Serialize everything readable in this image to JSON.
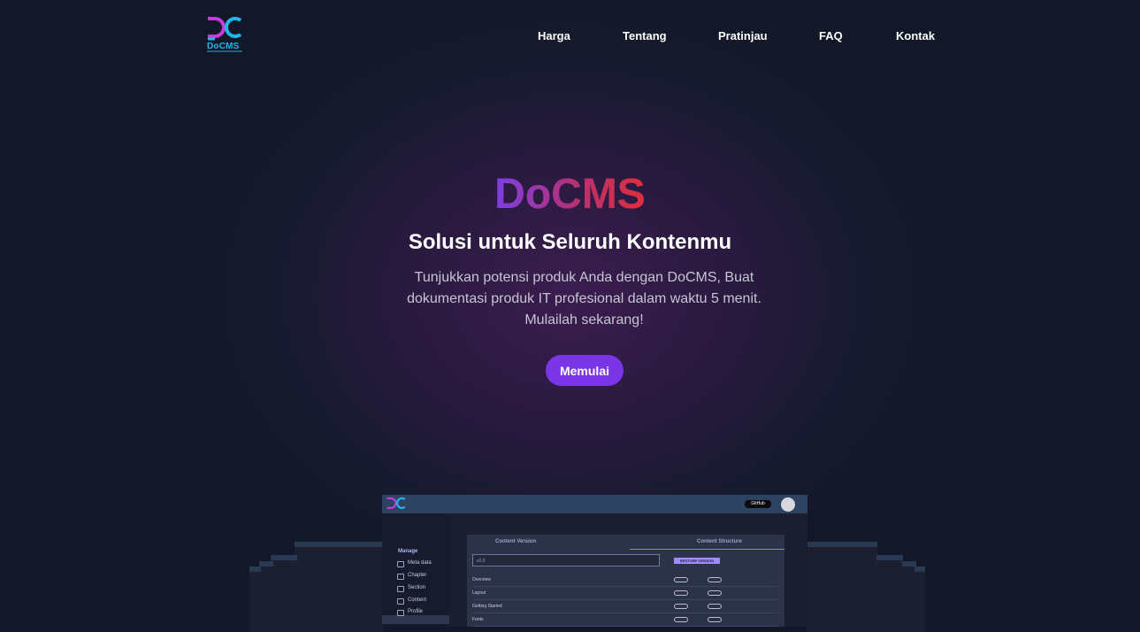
{
  "brand": {
    "name": "DoCMS"
  },
  "nav": {
    "items": [
      "Harga",
      "Tentang",
      "Pratinjau",
      "FAQ",
      "Kontak"
    ]
  },
  "hero": {
    "title": "DoCMS",
    "subtitle": "Solusi untuk Seluruh Kontenmu",
    "description": "Tunjukkan potensi produk Anda dengan DoCMS, Buat dokumentasi produk IT profesional dalam waktu 5 menit. Mulailah sekarang!",
    "cta_label": "Memulai"
  },
  "preview": {
    "github_label": "GitHub",
    "sidebar_heading": "Manage",
    "sidebar_items": [
      "Meta data",
      "Chapter",
      "Section",
      "Content",
      "Profile"
    ],
    "tabs": [
      "Content Version",
      "Content Structure"
    ],
    "input_value": "v2.0",
    "button_label": "RESTORE VERSION",
    "rows": [
      "Overview",
      "Layout",
      "Getting Started",
      "Fonts"
    ]
  },
  "colors": {
    "accent": "#7a36e6",
    "title_gradient_start": "#7b3fe4",
    "title_gradient_end": "#e02f3a",
    "background": "#161a2e"
  }
}
